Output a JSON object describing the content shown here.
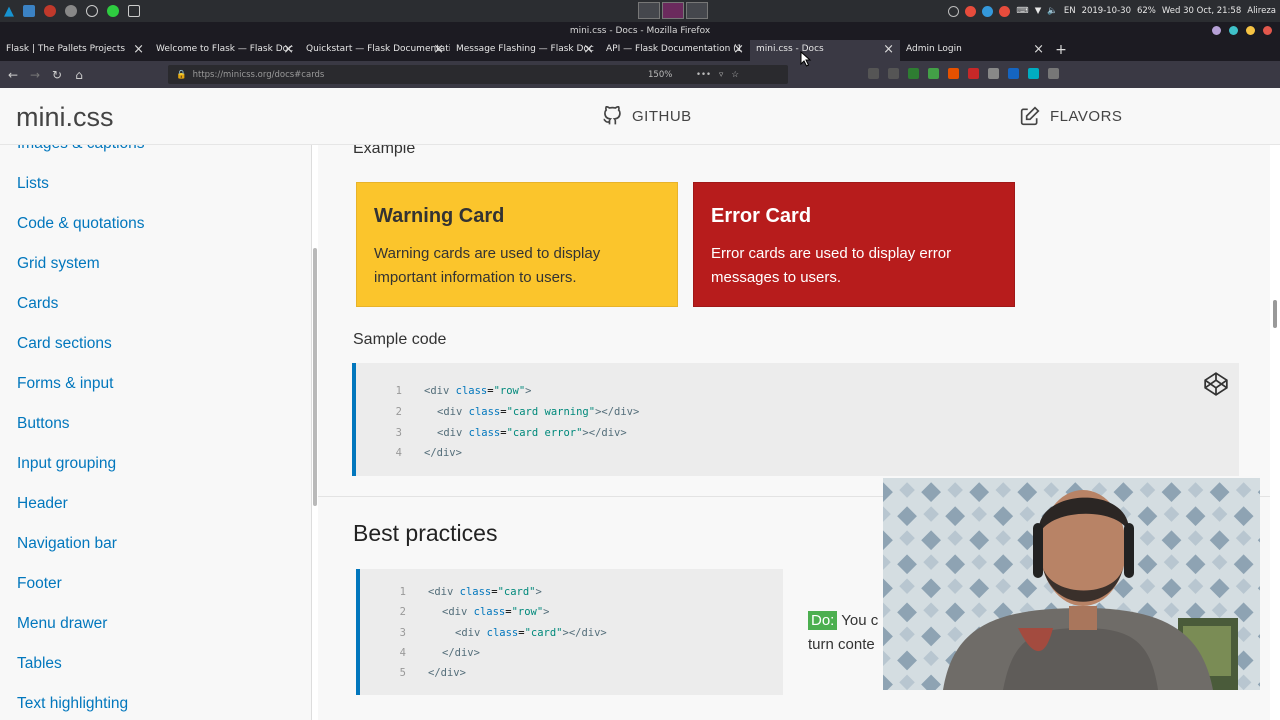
{
  "os": {
    "date": "2019-10-30",
    "battery": "62%",
    "clock": "Wed 30 Oct, 21:58",
    "lang": "EN",
    "user": "Alireza"
  },
  "window": {
    "title": "mini.css - Docs - Mozilla Firefox"
  },
  "tabs": [
    {
      "label": "Flask | The Pallets Projects"
    },
    {
      "label": "Welcome to Flask — Flask Doc"
    },
    {
      "label": "Quickstart — Flask Documentati"
    },
    {
      "label": "Message Flashing — Flask Doc"
    },
    {
      "label": "API — Flask Documentation (1"
    },
    {
      "label": "mini.css - Docs"
    },
    {
      "label": "Admin Login"
    }
  ],
  "urlbar": {
    "url": "https://minicss.org/docs#cards",
    "zoom": "150%"
  },
  "site": {
    "logo": "mini.css",
    "github_label": "GITHUB",
    "flavors_label": "FLAVORS"
  },
  "sidebar": {
    "items": [
      "Images & captions",
      "Lists",
      "Code & quotations",
      "Grid system",
      "Cards",
      "Card sections",
      "Forms & input",
      "Buttons",
      "Input grouping",
      "Header",
      "Navigation bar",
      "Footer",
      "Menu drawer",
      "Tables",
      "Text highlighting"
    ]
  },
  "main": {
    "example_heading": "Example",
    "warning_card": {
      "title": "Warning Card",
      "text": "Warning cards are used to display important information to users."
    },
    "error_card": {
      "title": "Error Card",
      "text": "Error cards are used to display error messages to users."
    },
    "sample_code_heading": "Sample code",
    "best_practices_heading": "Best practices",
    "do_badge": "Do:",
    "do_text_1": "You c",
    "do_text_2": "turn conte"
  }
}
